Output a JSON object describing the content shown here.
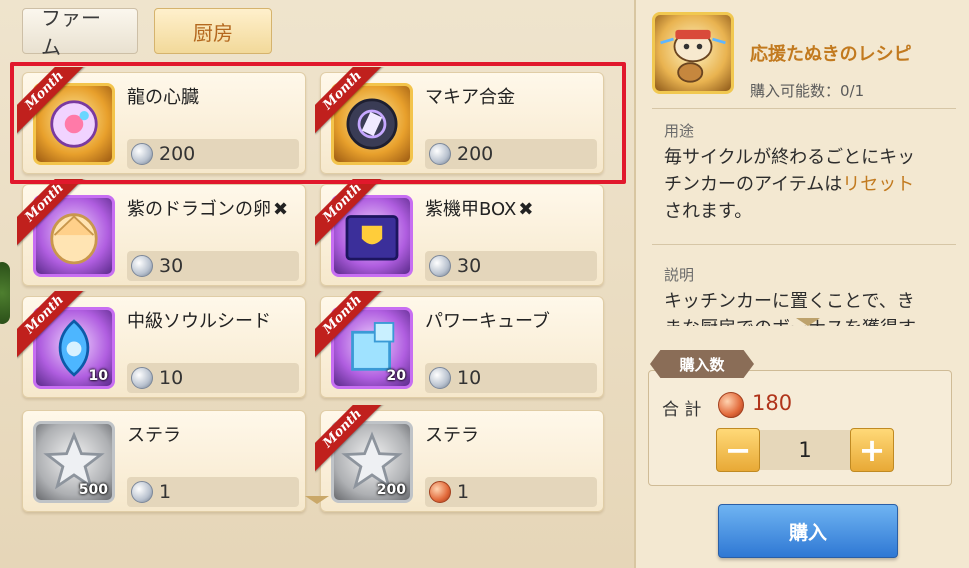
{
  "tabs": {
    "farm": "ファーム",
    "kitchen": "厨房"
  },
  "ribbon": "Month",
  "items": [
    {
      "name": "龍の心臓",
      "price": "200",
      "coin": "silver",
      "frame": "gold",
      "icon": "dragon-heart-icon",
      "month": true,
      "qty": "",
      "sold_out_mark": ""
    },
    {
      "name": "マキア合金",
      "price": "200",
      "coin": "silver",
      "frame": "gold",
      "icon": "machia-alloy-icon",
      "month": true,
      "qty": "",
      "sold_out_mark": ""
    },
    {
      "name": "紫のドラゴンの卵",
      "price": "30",
      "coin": "silver",
      "frame": "purple",
      "icon": "dragon-egg-icon",
      "month": true,
      "qty": "",
      "sold_out_mark": "✖"
    },
    {
      "name": "紫機甲BOX",
      "price": "30",
      "coin": "silver",
      "frame": "purple",
      "icon": "mech-box-icon",
      "month": true,
      "qty": "",
      "sold_out_mark": "✖"
    },
    {
      "name": "中級ソウルシード",
      "price": "10",
      "coin": "silver",
      "frame": "purple",
      "icon": "soul-seed-icon",
      "month": true,
      "qty": "10",
      "sold_out_mark": ""
    },
    {
      "name": "パワーキューブ",
      "price": "10",
      "coin": "silver",
      "frame": "purple",
      "icon": "power-cube-icon",
      "month": true,
      "qty": "20",
      "sold_out_mark": ""
    },
    {
      "name": "ステラ",
      "price": "1",
      "coin": "silver",
      "frame": "gray",
      "icon": "stella-star-icon",
      "month": false,
      "qty": "500",
      "sold_out_mark": ""
    },
    {
      "name": "ステラ",
      "price": "1",
      "coin": "copper",
      "frame": "gray",
      "icon": "stella-star-icon",
      "month": true,
      "qty": "200",
      "sold_out_mark": ""
    }
  ],
  "detail": {
    "title": "応援たぬきのレシピ",
    "limit": "購入可能数：0/1",
    "usage_label": "用途",
    "usage_text_1": "毎サイクルが終わるごとにキッ",
    "usage_text_2a": "チンカーのアイテムは",
    "usage_text_2b": "リセット",
    "usage_text_3": "されます。",
    "desc_label": "説明",
    "desc_text_1": "キッチンカーに置くことで、き",
    "desc_text_2": "まな厨房でのボーナスを獲得す"
  },
  "purchase": {
    "qty_label": "購入数",
    "total_label": "合 計",
    "total_value": "180",
    "quantity": "1",
    "minus": "−",
    "plus": "+",
    "buy_label": "購入"
  },
  "colors": {
    "highlight": "#e1182c",
    "accent": "#c27a1f",
    "buy": "#2f78d4"
  }
}
